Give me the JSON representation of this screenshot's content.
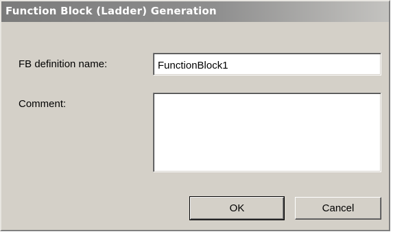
{
  "window": {
    "title": "Function Block (Ladder) Generation"
  },
  "form": {
    "fb_name_label": "FB definition name:",
    "fb_name_value": "FunctionBlock1",
    "comment_label": "Comment:",
    "comment_value": ""
  },
  "buttons": {
    "ok_label": "OK",
    "cancel_label": "Cancel"
  },
  "colors": {
    "dialog_background": "#d4d0c8",
    "title_bar": "#8e8e8e",
    "title_text": "#ffffff"
  }
}
